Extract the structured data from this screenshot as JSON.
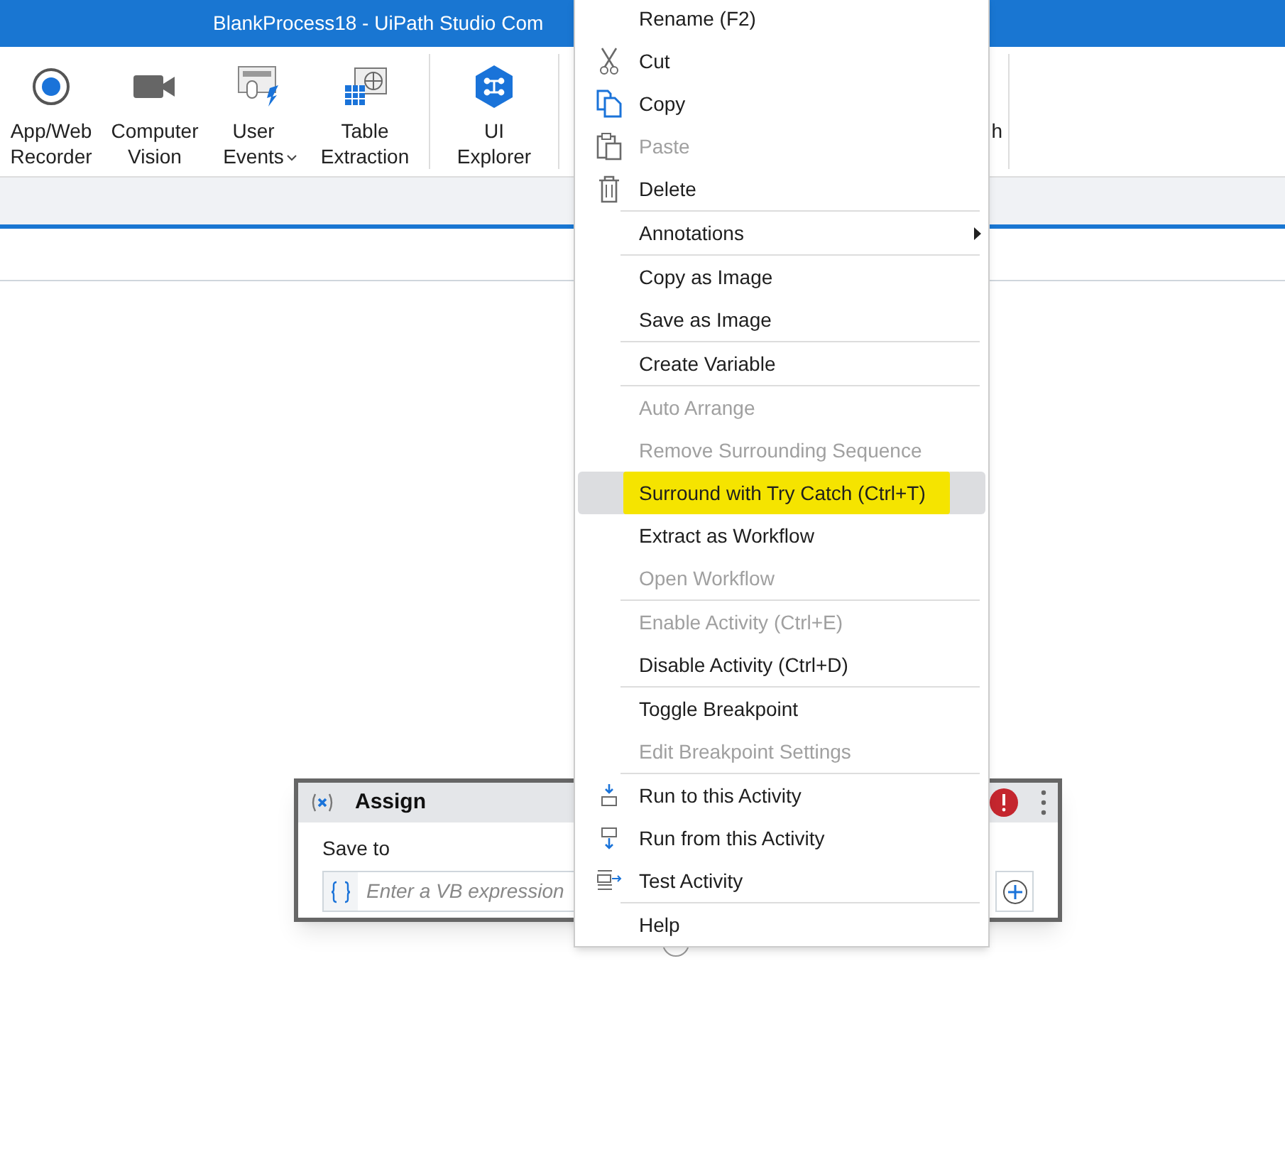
{
  "window": {
    "title": "BlankProcess18 - UiPath Studio Com"
  },
  "ribbon": {
    "buttons": [
      {
        "label": "App/Web\nRecorder",
        "kind": "record",
        "dropdown": false
      },
      {
        "label": "Computer\nVision",
        "kind": "camera",
        "dropdown": false
      },
      {
        "label": "User\nEvents",
        "kind": "events",
        "dropdown": true
      },
      {
        "label": "Table\nExtraction",
        "kind": "table",
        "dropdown": false
      },
      {
        "label": "UI\nExplorer",
        "kind": "explorer",
        "dropdown": false
      }
    ],
    "partial_label": "h"
  },
  "activity": {
    "title": "Assign",
    "field_label": "Save to",
    "placeholder": "Enter a VB expression",
    "error": true
  },
  "context_menu": {
    "sections": [
      [
        {
          "label": "Rename (F2)",
          "kind": "plain",
          "disabled": false,
          "selected": false,
          "submenu": false
        },
        {
          "label": "Cut",
          "kind": "cut",
          "disabled": false,
          "selected": false,
          "submenu": false
        },
        {
          "label": "Copy",
          "kind": "copy",
          "disabled": false,
          "selected": false,
          "submenu": false
        },
        {
          "label": "Paste",
          "kind": "paste",
          "disabled": true,
          "selected": false,
          "submenu": false
        },
        {
          "label": "Delete",
          "kind": "delete",
          "disabled": false,
          "selected": false,
          "submenu": false
        }
      ],
      [
        {
          "label": "Annotations",
          "kind": "plain",
          "disabled": false,
          "selected": false,
          "submenu": true
        }
      ],
      [
        {
          "label": "Copy as Image",
          "kind": "plain",
          "disabled": false,
          "selected": false,
          "submenu": false
        },
        {
          "label": "Save as Image",
          "kind": "plain",
          "disabled": false,
          "selected": false,
          "submenu": false
        }
      ],
      [
        {
          "label": "Create Variable",
          "kind": "plain",
          "disabled": false,
          "selected": false,
          "submenu": false
        }
      ],
      [
        {
          "label": "Auto Arrange",
          "kind": "plain",
          "disabled": true,
          "selected": false,
          "submenu": false
        },
        {
          "label": "Remove Surrounding Sequence",
          "kind": "plain",
          "disabled": true,
          "selected": false,
          "submenu": false
        },
        {
          "label": "Surround with Try Catch (Ctrl+T)",
          "kind": "plain",
          "disabled": false,
          "selected": true,
          "submenu": false
        },
        {
          "label": "Extract as Workflow",
          "kind": "plain",
          "disabled": false,
          "selected": false,
          "submenu": false
        },
        {
          "label": "Open Workflow",
          "kind": "plain",
          "disabled": true,
          "selected": false,
          "submenu": false
        }
      ],
      [
        {
          "label": "Enable Activity (Ctrl+E)",
          "kind": "plain",
          "disabled": true,
          "selected": false,
          "submenu": false
        },
        {
          "label": "Disable Activity (Ctrl+D)",
          "kind": "plain",
          "disabled": false,
          "selected": false,
          "submenu": false
        }
      ],
      [
        {
          "label": "Toggle Breakpoint",
          "kind": "plain",
          "disabled": false,
          "selected": false,
          "submenu": false
        },
        {
          "label": "Edit Breakpoint Settings",
          "kind": "plain",
          "disabled": true,
          "selected": false,
          "submenu": false
        }
      ],
      [
        {
          "label": "Run to this Activity",
          "kind": "run-to",
          "disabled": false,
          "selected": false,
          "submenu": false
        },
        {
          "label": "Run from this Activity",
          "kind": "run-from",
          "disabled": false,
          "selected": false,
          "submenu": false
        },
        {
          "label": "Test Activity",
          "kind": "test",
          "disabled": false,
          "selected": false,
          "submenu": false
        }
      ],
      [
        {
          "label": "Help",
          "kind": "plain",
          "disabled": false,
          "selected": false,
          "submenu": false
        }
      ]
    ]
  }
}
